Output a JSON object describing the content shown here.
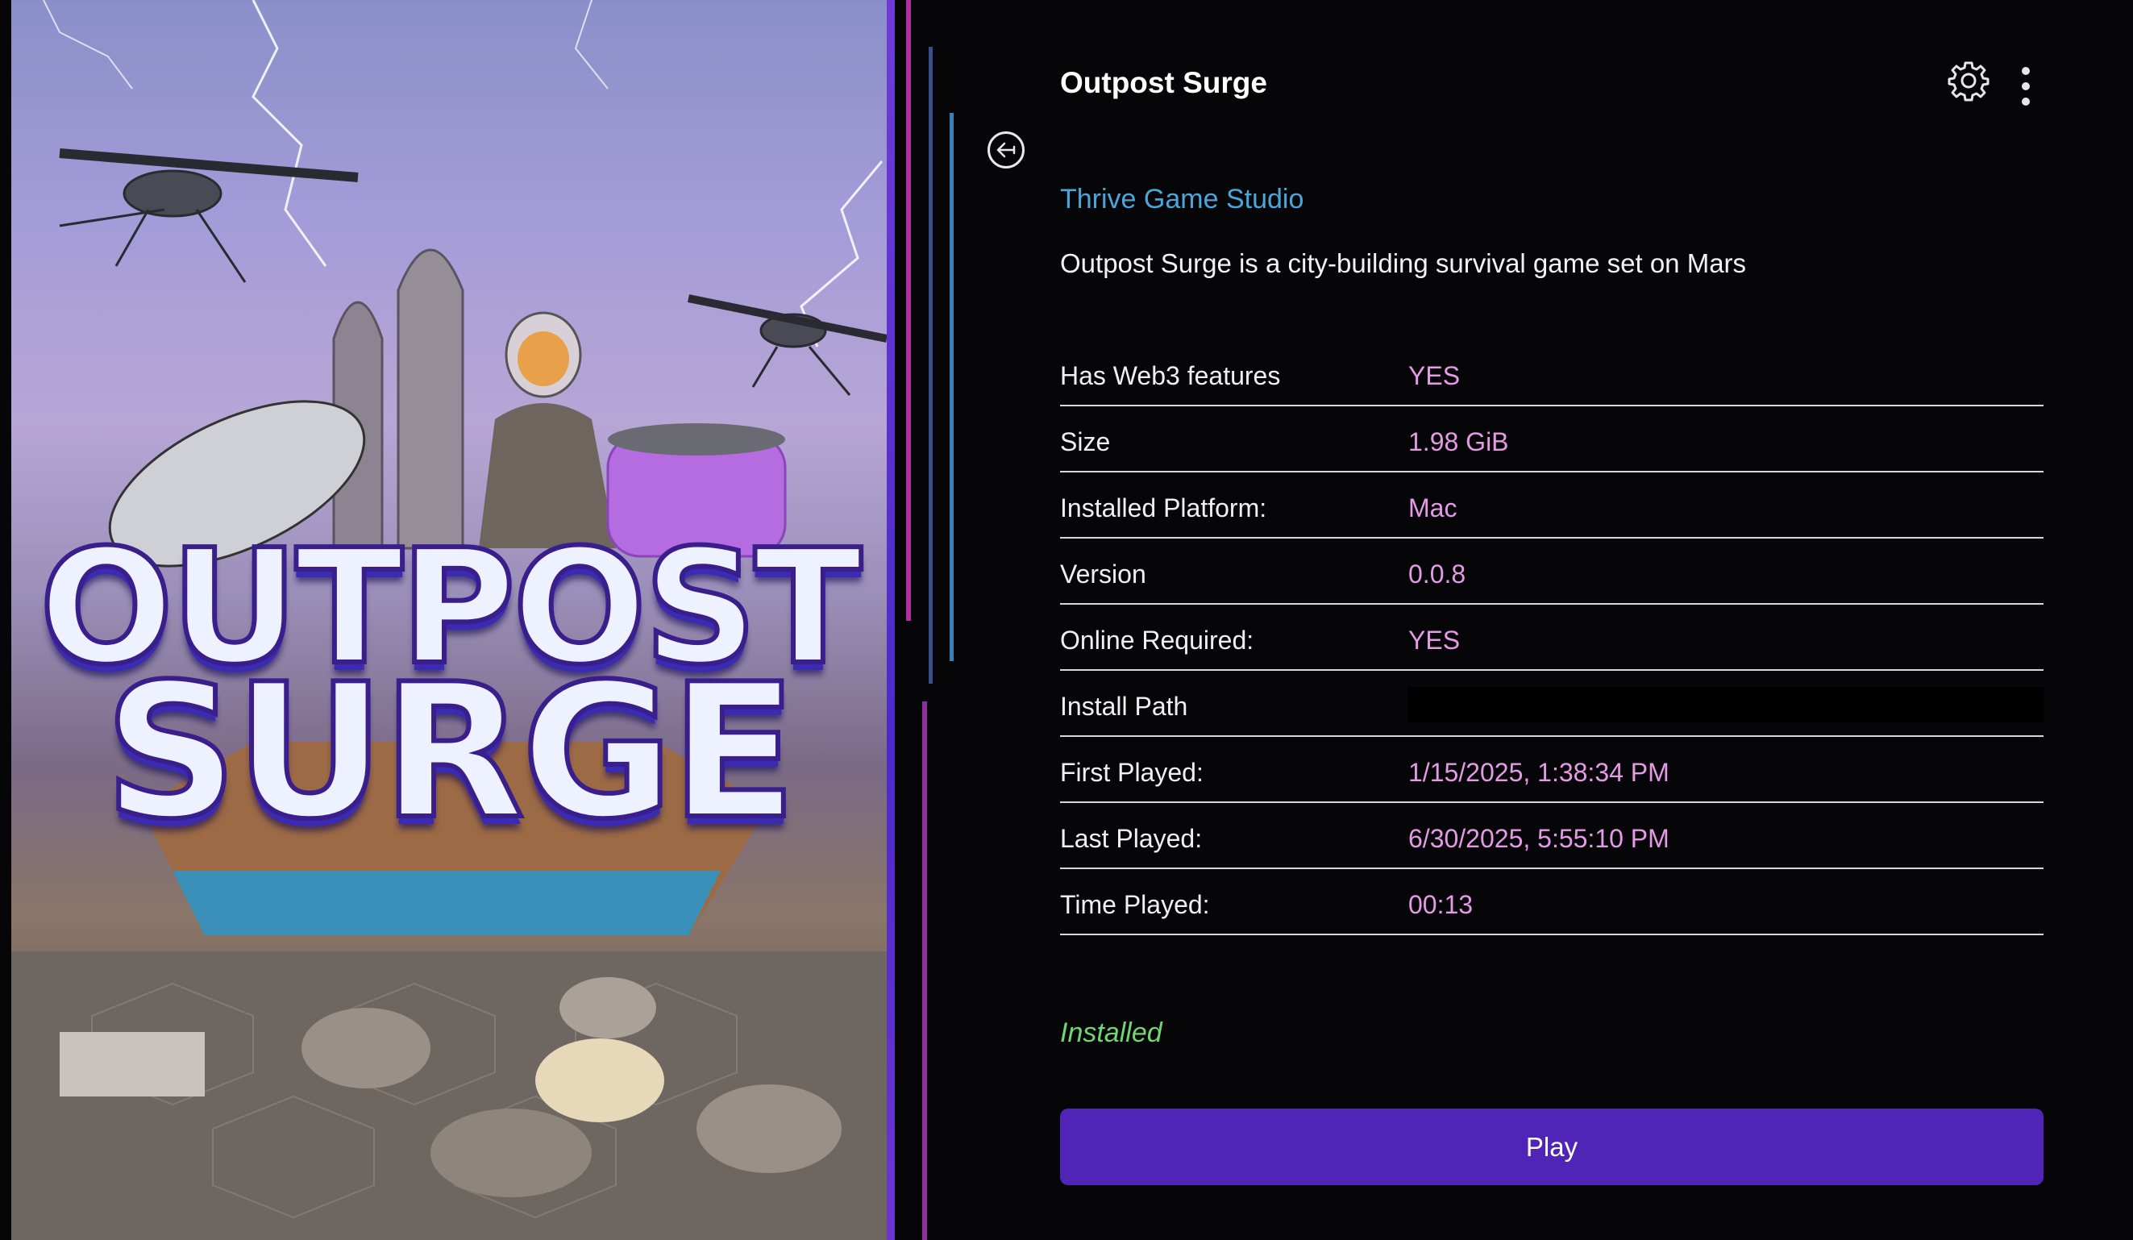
{
  "header": {
    "title": "Outpost Surge",
    "back_icon": "arrow-left-circle-icon",
    "settings_icon": "gear-icon",
    "more_icon": "vertical-ellipsis-icon"
  },
  "cover_art": {
    "logo_line1": "OUTPOST",
    "logo_line2": "SURGE"
  },
  "game": {
    "studio": "Thrive Game Studio",
    "description": "Outpost Surge is a city-building survival game set on Mars"
  },
  "details": [
    {
      "label": "Has Web3 features",
      "value": "YES"
    },
    {
      "label": "Size",
      "value": "1.98 GiB"
    },
    {
      "label": "Installed Platform:",
      "value": "Mac"
    },
    {
      "label": "Version",
      "value": "0.0.8"
    },
    {
      "label": "Online Required:",
      "value": "YES"
    },
    {
      "label": "Install Path",
      "value": null,
      "redacted": true
    },
    {
      "label": "First Played:",
      "value": "1/15/2025, 1:38:34 PM"
    },
    {
      "label": "Last Played:",
      "value": "6/30/2025, 5:55:10 PM"
    },
    {
      "label": "Time Played:",
      "value": "00:13"
    }
  ],
  "status_text": "Installed",
  "play_label": "Play",
  "colors": {
    "studio_link": "#4aa6db",
    "detail_value": "#e59ae5",
    "status_installed": "#72d472",
    "play_button": "#5124b8"
  }
}
